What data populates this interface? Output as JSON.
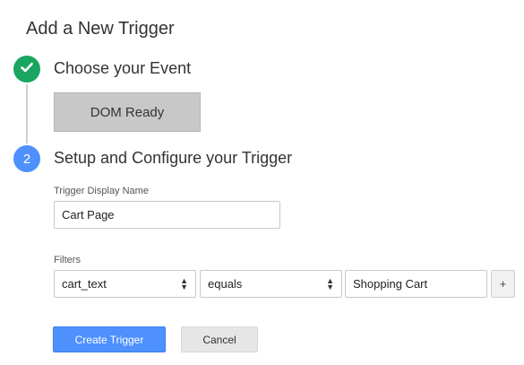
{
  "page": {
    "title": "Add a New Trigger"
  },
  "steps": [
    {
      "number": "",
      "status": "completed",
      "icon": "check-icon",
      "title": "Choose your Event",
      "color": "#1aa560"
    },
    {
      "number": "2",
      "status": "active",
      "title": "Setup and Configure your Trigger",
      "color": "#4d90fe"
    }
  ],
  "event": {
    "selected": "DOM Ready"
  },
  "config": {
    "name_label": "Trigger Display Name",
    "name_value": "Cart Page",
    "filters_label": "Filters",
    "filter": {
      "variable": "cart_text",
      "operator": "equals",
      "value": "Shopping Cart"
    },
    "add_filter_label": "+"
  },
  "actions": {
    "create_label": "Create Trigger",
    "cancel_label": "Cancel"
  },
  "colors": {
    "accent": "#4d90fe",
    "success": "#1aa560"
  }
}
